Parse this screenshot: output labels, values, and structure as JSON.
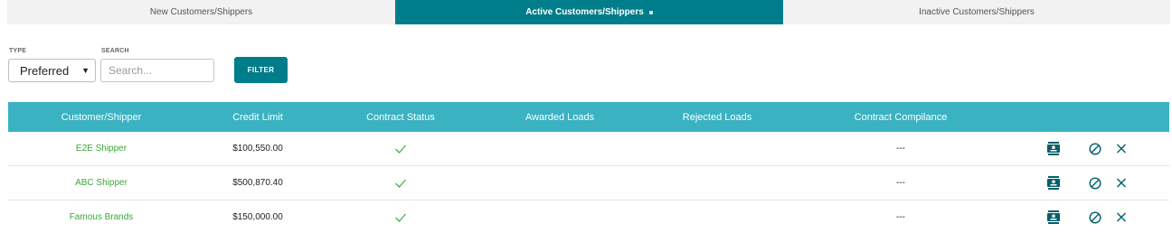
{
  "tabs": [
    {
      "label": "New Customers/Shippers"
    },
    {
      "label": "Active Customers/Shippers"
    },
    {
      "label": "Inactive Customers/Shippers"
    }
  ],
  "filters": {
    "type_label": "TYPE",
    "type_value": "Preferred",
    "search_label": "SEARCH",
    "search_placeholder": "Search...",
    "filter_button": "FILTER"
  },
  "table": {
    "headers": {
      "customer": "Customer/Shipper",
      "credit": "Credit Limit",
      "contract": "Contract Status",
      "awarded": "Awarded Loads",
      "rejected": "Rejected Loads",
      "compliance": "Contract Compilance"
    },
    "rows": [
      {
        "name": "E2E Shipper",
        "credit": "$100,550.00",
        "contract_status": "active",
        "awarded": "",
        "rejected": "",
        "compliance": "---"
      },
      {
        "name": "ABC Shipper",
        "credit": "$500,870.40",
        "contract_status": "active",
        "awarded": "",
        "rejected": "",
        "compliance": "---"
      },
      {
        "name": "Famous Brands",
        "credit": "$150,000.00",
        "contract_status": "active",
        "awarded": "",
        "rejected": "",
        "compliance": "---"
      }
    ]
  },
  "icons": {
    "contact": "contact-card-icon",
    "block": "block-icon",
    "remove": "close-icon",
    "check": "check-icon"
  },
  "colors": {
    "active_tab": "#007d8a",
    "table_header": "#3ab2c2",
    "link_green": "#3aa83a",
    "icon_teal": "#00606b"
  }
}
